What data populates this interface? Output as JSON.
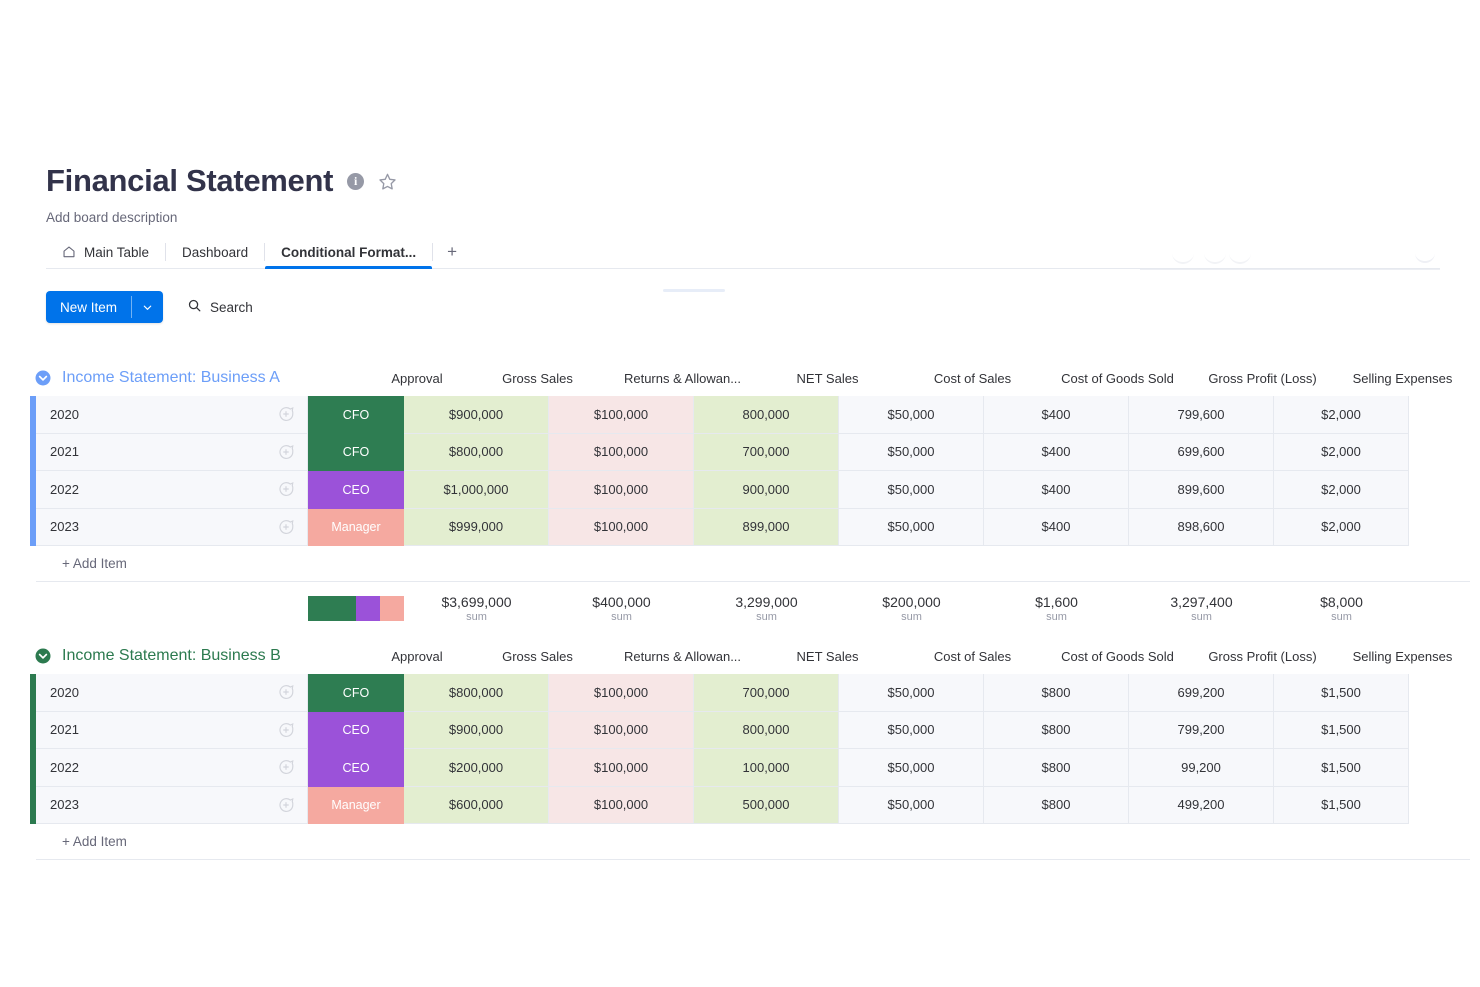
{
  "header": {
    "title": "Financial Statement",
    "description": "Add board description",
    "info_icon": "info-icon",
    "star_icon": "star-icon"
  },
  "tabs": [
    {
      "label": "Main Table",
      "icon": "home-icon",
      "active": false
    },
    {
      "label": "Dashboard",
      "icon": "",
      "active": false
    },
    {
      "label": "Conditional Format...",
      "icon": "",
      "active": true
    }
  ],
  "tab_add_label": "+",
  "toolbar": {
    "new_item_label": "New Item",
    "new_item_caret": "chevron-down-icon",
    "search_label": "Search",
    "search_icon": "search-icon"
  },
  "columns": [
    "Approval",
    "Gross Sales",
    "Returns & Allowan...",
    "NET Sales",
    "Cost of Sales",
    "Cost of Goods Sold",
    "Gross Profit (Loss)",
    "Selling Expenses"
  ],
  "colors": {
    "group_a": "#6c9ef8",
    "group_b": "#2c7a4f",
    "status_cfo": "#2e7d52",
    "status_ceo": "#9b52d9",
    "status_manager": "#f5a9a0",
    "accent_blue": "#0073ea",
    "green_cell": "#e3eed0",
    "pink_cell": "#f7e6e6",
    "row_bg": "#f7f8fb"
  },
  "add_item_label": "+ Add Item",
  "sum_label": "sum",
  "groups": [
    {
      "name": "Income Statement: Business A",
      "color": "#6c9ef8",
      "caret_icon": "chevron-down-circle-icon",
      "rows": [
        {
          "name": "2020",
          "approval": "CFO",
          "approval_color": "#2e7d52",
          "gross_sales": "$900,000",
          "returns": "$100,000",
          "net_sales": "800,000",
          "cost_of_sales": "$50,000",
          "cogs": "$400",
          "gross_profit": "799,600",
          "selling": "$2,000"
        },
        {
          "name": "2021",
          "approval": "CFO",
          "approval_color": "#2e7d52",
          "gross_sales": "$800,000",
          "returns": "$100,000",
          "net_sales": "700,000",
          "cost_of_sales": "$50,000",
          "cogs": "$400",
          "gross_profit": "699,600",
          "selling": "$2,000"
        },
        {
          "name": "2022",
          "approval": "CEO",
          "approval_color": "#9b52d9",
          "gross_sales": "$1,000,000",
          "returns": "$100,000",
          "net_sales": "900,000",
          "cost_of_sales": "$50,000",
          "cogs": "$400",
          "gross_profit": "899,600",
          "selling": "$2,000"
        },
        {
          "name": "2023",
          "approval": "Manager",
          "approval_color": "#f5a9a0",
          "gross_sales": "$999,000",
          "returns": "$100,000",
          "net_sales": "899,000",
          "cost_of_sales": "$50,000",
          "cogs": "$400",
          "gross_profit": "898,600",
          "selling": "$2,000"
        }
      ],
      "summary": {
        "approval_stack": [
          {
            "color": "#2e7d52",
            "pct": 50
          },
          {
            "color": "#9b52d9",
            "pct": 25
          },
          {
            "color": "#f5a9a0",
            "pct": 25
          }
        ],
        "gross_sales": "$3,699,000",
        "returns": "$400,000",
        "net_sales": "3,299,000",
        "cost_of_sales": "$200,000",
        "cogs": "$1,600",
        "gross_profit": "3,297,400",
        "selling": "$8,000"
      }
    },
    {
      "name": "Income Statement: Business B",
      "color": "#2c7a4f",
      "caret_icon": "chevron-down-circle-icon",
      "rows": [
        {
          "name": "2020",
          "approval": "CFO",
          "approval_color": "#2e7d52",
          "gross_sales": "$800,000",
          "returns": "$100,000",
          "net_sales": "700,000",
          "cost_of_sales": "$50,000",
          "cogs": "$800",
          "gross_profit": "699,200",
          "selling": "$1,500"
        },
        {
          "name": "2021",
          "approval": "CEO",
          "approval_color": "#9b52d9",
          "gross_sales": "$900,000",
          "returns": "$100,000",
          "net_sales": "800,000",
          "cost_of_sales": "$50,000",
          "cogs": "$800",
          "gross_profit": "799,200",
          "selling": "$1,500"
        },
        {
          "name": "2022",
          "approval": "CEO",
          "approval_color": "#9b52d9",
          "gross_sales": "$200,000",
          "returns": "$100,000",
          "net_sales": "100,000",
          "cost_of_sales": "$50,000",
          "cogs": "$800",
          "gross_profit": "99,200",
          "selling": "$1,500"
        },
        {
          "name": "2023",
          "approval": "Manager",
          "approval_color": "#f5a9a0",
          "gross_sales": "$600,000",
          "returns": "$100,000",
          "net_sales": "500,000",
          "cost_of_sales": "$50,000",
          "cogs": "$800",
          "gross_profit": "499,200",
          "selling": "$1,500"
        }
      ],
      "summary": null
    }
  ]
}
